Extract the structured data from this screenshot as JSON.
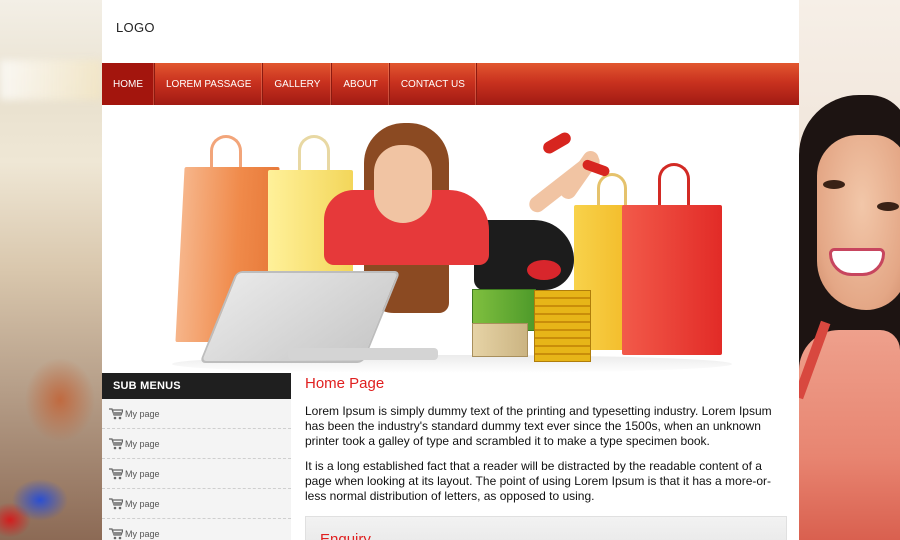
{
  "header": {
    "logo": "LOGO"
  },
  "nav": {
    "items": [
      {
        "label": "HOME"
      },
      {
        "label": "LOREM PASSAGE"
      },
      {
        "label": "GALLERY"
      },
      {
        "label": "ABOUT"
      },
      {
        "label": "CONTACT US"
      }
    ],
    "active": "HOME"
  },
  "sidebar": {
    "heading": "SUB MENUS",
    "items": [
      {
        "label": "My page",
        "icon": "cart-icon"
      },
      {
        "label": "My page",
        "icon": "cart-icon"
      },
      {
        "label": "My page",
        "icon": "cart-icon"
      },
      {
        "label": "My page",
        "icon": "cart-icon"
      },
      {
        "label": "My page",
        "icon": "cart-icon"
      }
    ]
  },
  "content": {
    "title": "Home Page",
    "paragraphs": [
      "Lorem Ipsum is simply dummy text of the printing and typesetting industry. Lorem Ipsum has been the industry's standard dummy text ever since the 1500s, when an unknown printer took a galley of type and scrambled it to make a type specimen book.",
      "It is a long established fact that a reader will be distracted by the readable content of a page when looking at its layout. The point of using Lorem Ipsum is that it has a more-or-less normal distribution of letters, as opposed to using."
    ],
    "enquiry_title": "Enquiry"
  },
  "colors": {
    "nav_red": "#c9321f",
    "title_red": "#e02020",
    "sidebar_head": "#1f1f1f"
  }
}
